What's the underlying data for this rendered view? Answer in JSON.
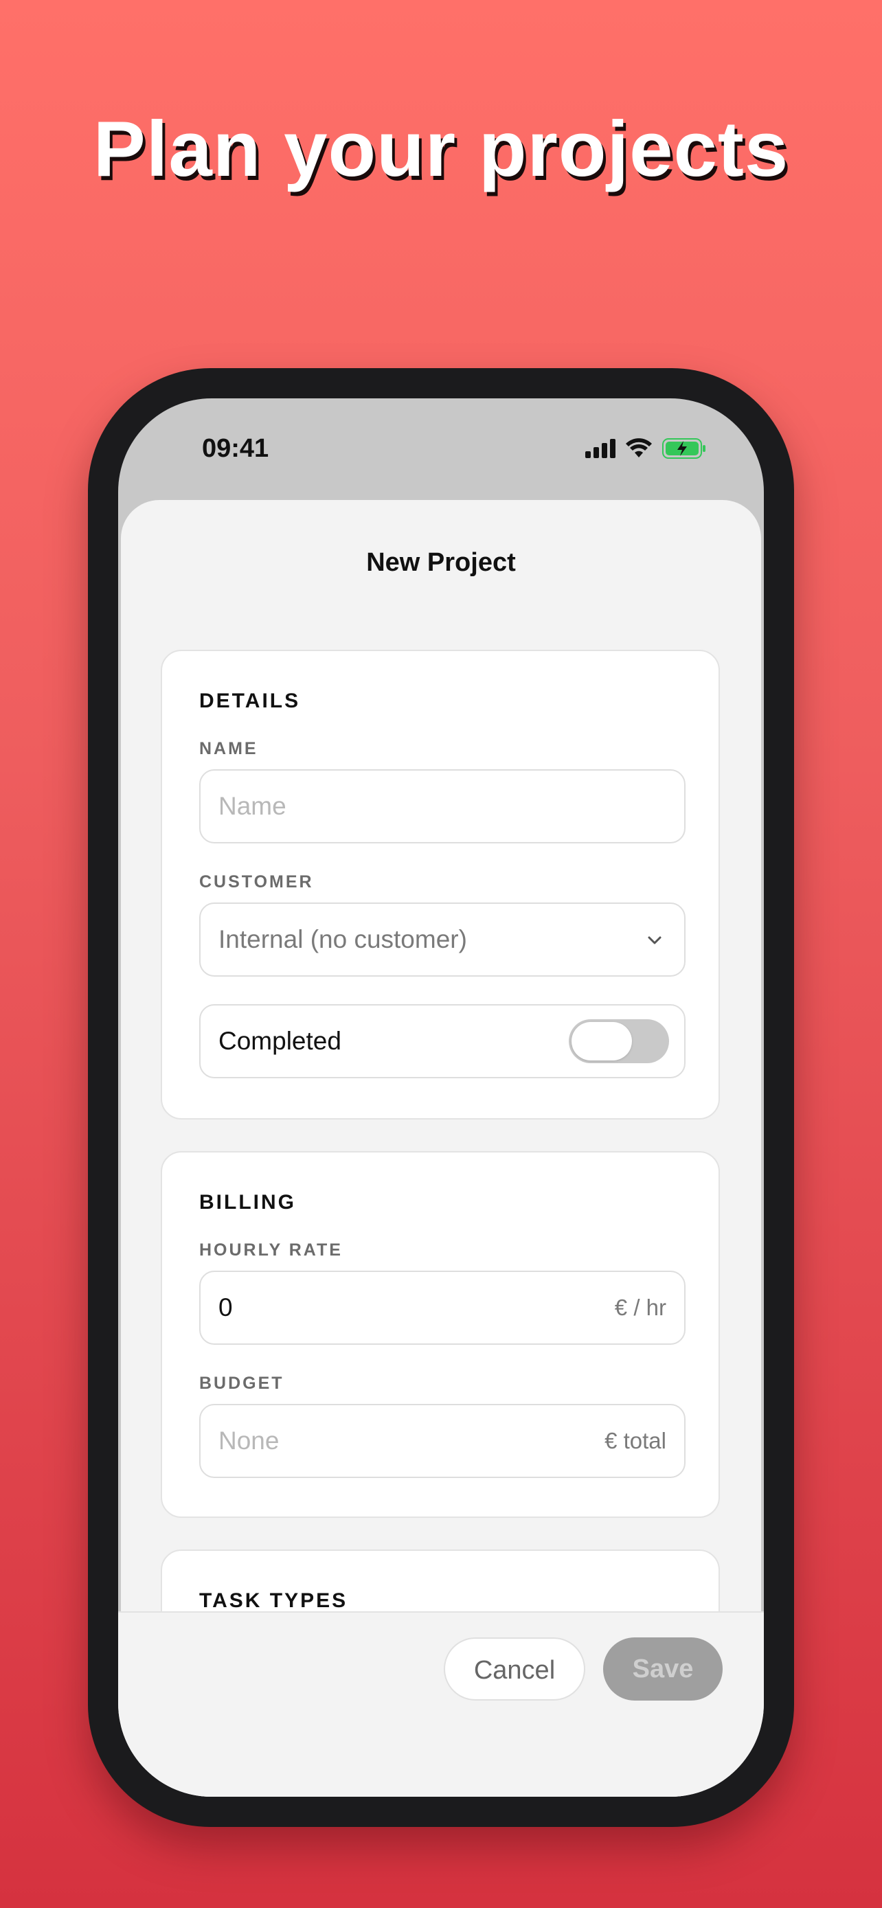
{
  "headline": "Plan your projects",
  "status_bar": {
    "time": "09:41",
    "icons": [
      "cellular-signal-icon",
      "wifi-icon",
      "battery-charging-icon"
    ],
    "battery_color": "#34c759"
  },
  "sheet": {
    "title": "New Project"
  },
  "details": {
    "title": "DETAILS",
    "name_label": "NAME",
    "name_placeholder": "Name",
    "customer_label": "CUSTOMER",
    "customer_value": "Internal (no customer)",
    "completed_label": "Completed",
    "completed_on": false
  },
  "billing": {
    "title": "BILLING",
    "hourly_rate_label": "HOURLY RATE",
    "hourly_rate_value": "0",
    "hourly_rate_suffix": "€ / hr",
    "budget_label": "BUDGET",
    "budget_placeholder": "None",
    "budget_suffix": "€ total"
  },
  "task_types": {
    "title": "TASK TYPES"
  },
  "footer": {
    "cancel_label": "Cancel",
    "save_label": "Save"
  },
  "colors": {
    "background_top": "#ff7069",
    "background_bottom": "#d5323f",
    "save_disabled": "#9f9f9f"
  }
}
